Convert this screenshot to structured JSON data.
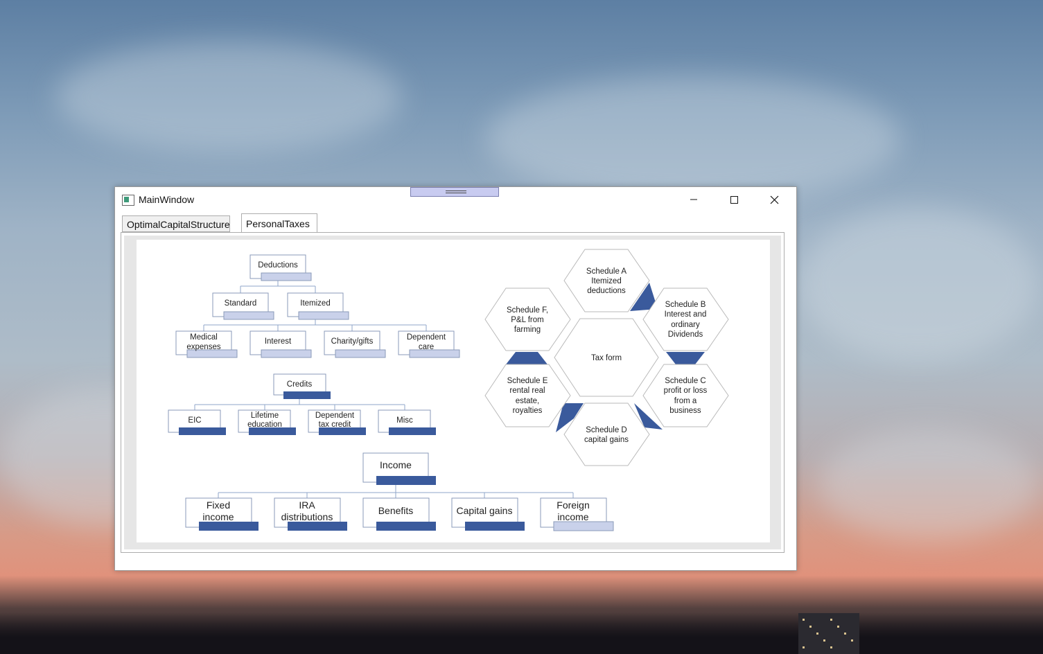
{
  "window": {
    "title": "MainWindow"
  },
  "tabs": [
    {
      "label": "OptimalCapitalStructure",
      "selected": false
    },
    {
      "label": "PersonalTaxes",
      "selected": true
    }
  ],
  "deductions": {
    "root": "Deductions",
    "level2": [
      "Standard",
      "Itemized"
    ],
    "level3": [
      [
        "Medical",
        "expenses"
      ],
      [
        "Interest"
      ],
      [
        "Charity/gifts"
      ],
      [
        "Dependent",
        "care"
      ]
    ]
  },
  "credits": {
    "root": "Credits",
    "children": [
      [
        "EIC"
      ],
      [
        "Lifetime",
        "education"
      ],
      [
        "Dependent",
        "tax credit"
      ],
      [
        "Misc"
      ]
    ]
  },
  "income": {
    "root": "Income",
    "children": [
      [
        "Fixed",
        "income"
      ],
      [
        "IRA",
        "distributions"
      ],
      [
        "Benefits"
      ],
      [
        "Capital gains"
      ],
      [
        "Foreign",
        "income"
      ]
    ]
  },
  "hexagons": {
    "center": [
      "Tax form"
    ],
    "a": [
      "Schedule A",
      "Itemized",
      "deductions"
    ],
    "b": [
      "Schedule B",
      "Interest and",
      "ordinary",
      "Dividends"
    ],
    "c": [
      "Schedule C",
      "profit or loss",
      "from a",
      "business"
    ],
    "d": [
      "Schedule D",
      "capital gains"
    ],
    "e": [
      "Schedule E",
      "rental real",
      "estate,",
      "royalties"
    ],
    "f": [
      "Schedule F,",
      "P&L from",
      "farming"
    ]
  },
  "colors": {
    "accent_dark": "#3a5a9c",
    "accent_light": "#c9d1ea",
    "connector": "#8fa6c8",
    "box_border": "#8a9ab8"
  }
}
